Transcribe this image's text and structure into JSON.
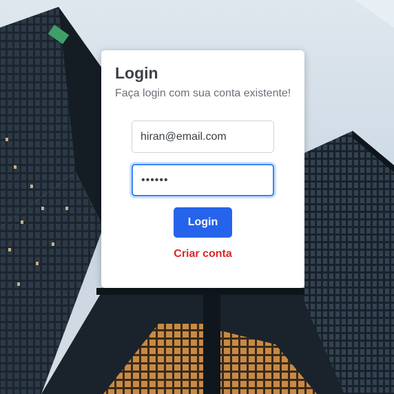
{
  "login": {
    "title": "Login",
    "subtitle": "Faça login com sua conta existente!",
    "email_value": "hiran@email.com",
    "password_value": "••••••",
    "submit_label": "Login",
    "create_account_label": "Criar conta"
  },
  "colors": {
    "primary_button": "#2563eb",
    "link_red": "#dc2626",
    "focus_ring": "#3b82f6"
  }
}
